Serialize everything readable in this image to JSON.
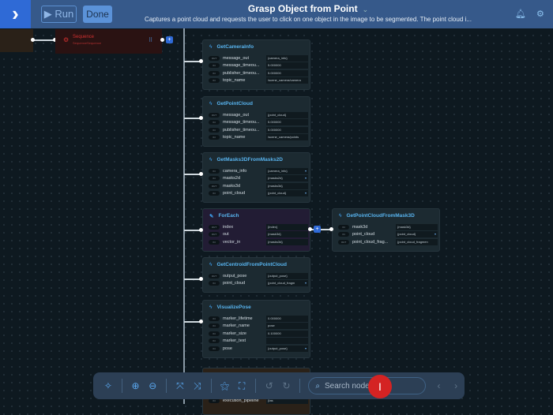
{
  "header": {
    "run_label": "Run",
    "done_label": "Done",
    "title": "Grasp Object from Point",
    "description": "Captures a point cloud and requests the user to click on one object in the image to be segmented. The point cloud i..."
  },
  "sequence": {
    "title": "Sequence",
    "subtitle": "SequenceSequence"
  },
  "colors": {
    "accent": "#2f6ad6",
    "header": "#36598a",
    "node_title": "#58b4ef"
  },
  "nodes": [
    {
      "title": "GetCameraInfo",
      "icon": "bolt",
      "rows": [
        [
          "OUT",
          "message_out",
          "{camera_info}",
          ""
        ],
        [
          "IN",
          "message_timeou...",
          "5.000000",
          ""
        ],
        [
          "IN",
          "publisher_timeou...",
          "5.000000",
          ""
        ],
        [
          "IN",
          "topic_name",
          "/scene_camera/camera",
          ""
        ]
      ]
    },
    {
      "title": "GetPointCloud",
      "icon": "bolt",
      "rows": [
        [
          "OUT",
          "message_out",
          "{point_cloud}",
          ""
        ],
        [
          "IN",
          "message_timeou...",
          "5.000000",
          ""
        ],
        [
          "IN",
          "publisher_timeou...",
          "5.000000",
          ""
        ],
        [
          "IN",
          "topic_name",
          "/scene_camera/points",
          ""
        ]
      ]
    },
    {
      "title": "GetMasks3DFromMasks2D",
      "icon": "bolt",
      "rows": [
        [
          "IN",
          "camera_info",
          "{camera_info}",
          "▾"
        ],
        [
          "IN",
          "masks2d",
          "{masks2d}",
          "▾"
        ],
        [
          "OUT",
          "masks3d",
          "{masks3d}",
          ""
        ],
        [
          "IN",
          "point_cloud",
          "{point_cloud}",
          "▾"
        ]
      ]
    },
    {
      "title": "ForEach",
      "icon": "wand",
      "rows": [
        [
          "OUT",
          "index",
          "{index}",
          ""
        ],
        [
          "OUT",
          "out",
          "{mask3d}",
          ""
        ],
        [
          "IN",
          "vector_in",
          "{masks3d}",
          ""
        ]
      ]
    },
    {
      "title": "GetPointCloudFromMask3D",
      "icon": "bolt",
      "rows": [
        [
          "IN",
          "mask3d",
          "{mask3d}",
          ""
        ],
        [
          "IN",
          "point_cloud",
          "{point_cloud}",
          "▾"
        ],
        [
          "OUT",
          "point_cloud_frag...",
          "{point_cloud_fragmen",
          ""
        ]
      ]
    },
    {
      "title": "GetCentroidFromPointCloud",
      "icon": "bolt",
      "rows": [
        [
          "OUT",
          "output_pose",
          "{output_pose}",
          ""
        ],
        [
          "IN",
          "point_cloud",
          "{point_cloud_fragm",
          "▾"
        ]
      ]
    },
    {
      "title": "VisualizePose",
      "icon": "bolt",
      "rows": [
        [
          "IN",
          "marker_lifetime",
          "0.000000",
          ""
        ],
        [
          "IN",
          "marker_name",
          "pose",
          ""
        ],
        [
          "IN",
          "marker_size",
          "0.100000",
          ""
        ],
        [
          "IN",
          "marker_text",
          "",
          ""
        ],
        [
          "IN",
          "pose",
          "{output_pose}",
          "▾"
        ]
      ]
    },
    {
      "title": "",
      "icon": "",
      "rows": [
        [
          "IN",
          "execution_pipeline",
          "{tas",
          ""
        ]
      ]
    }
  ],
  "toolbar": {
    "search_placeholder": "Search nodes"
  }
}
